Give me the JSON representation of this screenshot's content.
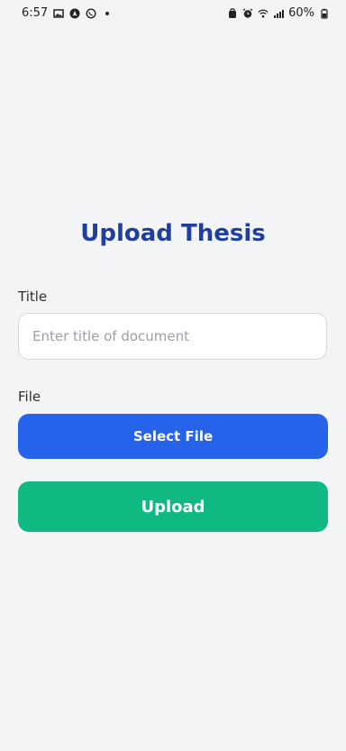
{
  "status_bar": {
    "time": "6:57",
    "battery": "60%",
    "left_icons": [
      "image-icon",
      "navigation-icon",
      "whatsapp-icon",
      "notification-dot-icon"
    ],
    "right_icons": [
      "alarm-icon",
      "alarm-clock-icon",
      "wifi-icon",
      "signal-icon",
      "battery-icon"
    ]
  },
  "page": {
    "title": "Upload Thesis"
  },
  "form": {
    "title_label": "Title",
    "title_placeholder": "Enter title of document",
    "title_value": "",
    "file_label": "File",
    "select_file_label": "Select File",
    "upload_label": "Upload"
  },
  "colors": {
    "background": "#f3f4f6",
    "title": "#1f3f9f",
    "select_button": "#2563eb",
    "upload_button": "#10b981"
  }
}
